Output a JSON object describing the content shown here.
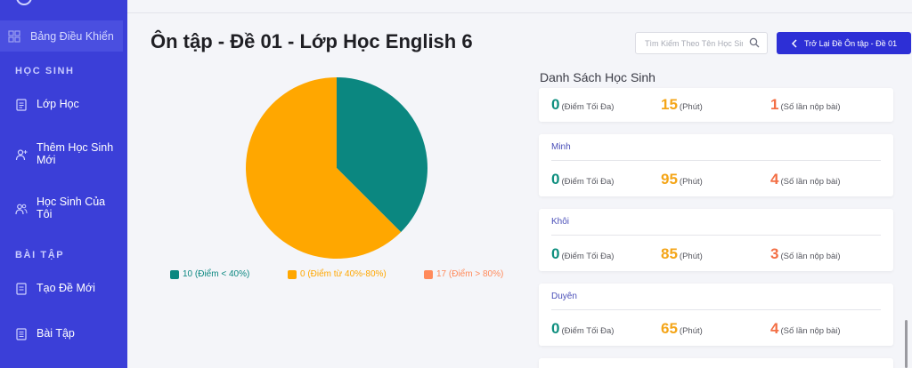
{
  "sidebar": {
    "dashboard_label": "Bảng Điều Khiển",
    "section_students": "HỌC SINH",
    "section_exercises": "BÀI TẬP",
    "items": [
      {
        "label": "Lớp Học",
        "icon": "document-icon"
      },
      {
        "label": "Thêm Học Sinh Mới",
        "icon": "add-user-icon"
      },
      {
        "label": "Học Sinh Của Tôi",
        "icon": "users-icon"
      },
      {
        "label": "Tạo Đề Mới",
        "icon": "edit-document-icon"
      },
      {
        "label": "Bài Tập",
        "icon": "list-icon"
      }
    ]
  },
  "header": {
    "title": "Ôn tập - Đề 01 - Lớp Học English 6",
    "search_placeholder": "Tìm Kiếm Theo Tên Học Sinh",
    "back_label": "Trở Lại Đề Ôn tập - Đề 01"
  },
  "colors": {
    "sidebar": "#3b3fd8",
    "accent_button": "#2d2fd6",
    "teal": "#0b8780",
    "amber": "#ffa700",
    "salmon": "#ff8a5b"
  },
  "chart_data": {
    "type": "pie",
    "slices": [
      {
        "label": "10 (Điểm < 40%)",
        "value": 10,
        "color": "#0b8780"
      },
      {
        "label": "0 (Điểm từ 40%-80%)",
        "value": 0,
        "color": "#ffa700"
      },
      {
        "label": "17 (Điểm > 80%)",
        "value": 17,
        "color": "#ff8a5b"
      }
    ],
    "visible_fractions": [
      0.375,
      0.625
    ],
    "visible_colors": [
      "#0b8780",
      "#ffa700"
    ],
    "legend_position": "bottom"
  },
  "students": {
    "title": "Danh Sách Học Sinh",
    "score_unit": "(Điểm Tối Đa)",
    "time_unit": "(Phút)",
    "attempts_unit": "(Số lần nộp bài)",
    "rows": [
      {
        "name": "",
        "score": "0",
        "time": "15",
        "attempts": "1"
      },
      {
        "name": "Minh",
        "score": "0",
        "time": "95",
        "attempts": "4"
      },
      {
        "name": "Khôi",
        "score": "0",
        "time": "85",
        "attempts": "3"
      },
      {
        "name": "Duyên",
        "score": "0",
        "time": "65",
        "attempts": "4"
      }
    ]
  }
}
